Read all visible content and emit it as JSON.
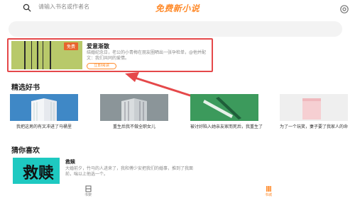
{
  "app": {
    "title": "免费新小说"
  },
  "search": {
    "placeholder": "请输入书名或作者名"
  },
  "featured": {
    "badge": "免费",
    "title": "爱意渐散",
    "description": "结婚纪念日，老公的小青梅在朋友圈晒出一张孕检单，@他并配文：我们共同的爱情。",
    "button_label": "立即阅读",
    "cover_color": "#b8c96a"
  },
  "featured_books": {
    "heading": "精选好书",
    "items": [
      {
        "title": "我把这男的有叉冲进了马桶里",
        "cover_color": "#3f88c6"
      },
      {
        "title": "重生后我不做全职女儿",
        "cover_color": "#8b9599"
      },
      {
        "title": "被讨好陷入她亲友家而死后，我重生了",
        "cover_color": "#3c9a5c"
      },
      {
        "title": "为了一个玩笑，妻子要了我家人的命",
        "cover_color": "#efefef"
      }
    ]
  },
  "guess": {
    "heading": "猜你喜欢",
    "title": "救赎",
    "cover_text": "救赎",
    "description": "大婚前夕，竹马的人进来了，我和傅少安把我们的婚事，推到了我面前，喘以上他选一个。",
    "cover_color": "#1ec9c1"
  },
  "bottom_nav": [
    {
      "label": "书架",
      "icon": "bookshelf-icon",
      "active": false
    },
    {
      "label": "书城",
      "icon": "bookstore-icon",
      "active": true
    }
  ],
  "colors": {
    "accent": "#ff8a2a",
    "highlight": "#e5484a"
  }
}
